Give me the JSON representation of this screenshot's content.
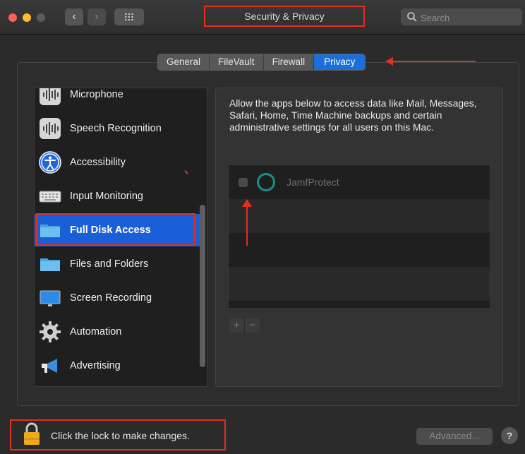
{
  "window": {
    "title": "Security & Privacy",
    "traffic_lights": [
      "#fe5f57",
      "#febc2e",
      "#5b5b5b"
    ]
  },
  "toolbar": {
    "back_glyph": "‹",
    "forward_glyph": "›",
    "grid_icon": "grid-icon",
    "search_placeholder": "Search"
  },
  "tabs": [
    {
      "label": "General",
      "active": false
    },
    {
      "label": "FileVault",
      "active": false
    },
    {
      "label": "Firewall",
      "active": false
    },
    {
      "label": "Privacy",
      "active": true
    }
  ],
  "sidebar": {
    "items": [
      {
        "label": "Microphone",
        "icon": "microphone-icon"
      },
      {
        "label": "Speech Recognition",
        "icon": "speech-recognition-icon"
      },
      {
        "label": "Accessibility",
        "icon": "accessibility-icon"
      },
      {
        "label": "Input Monitoring",
        "icon": "keyboard-icon"
      },
      {
        "label": "Full Disk Access",
        "icon": "folder-icon",
        "selected": true
      },
      {
        "label": "Files and Folders",
        "icon": "folder-icon"
      },
      {
        "label": "Screen Recording",
        "icon": "display-icon"
      },
      {
        "label": "Automation",
        "icon": "gear-icon"
      },
      {
        "label": "Advertising",
        "icon": "megaphone-icon"
      }
    ]
  },
  "main": {
    "description": "Allow the apps below to access data like Mail, Messages, Safari, Home, Time Machine backups and certain administrative settings for all users on this Mac.",
    "apps": [
      {
        "name": "JamfProtect",
        "checked": false
      }
    ],
    "add_label": "+",
    "remove_label": "−"
  },
  "footer": {
    "lock_text": "Click the lock to make changes.",
    "advanced_label": "Advanced...",
    "help_label": "?"
  },
  "colors": {
    "accent": "#1a6fd9",
    "annotation": "#e0301e"
  }
}
